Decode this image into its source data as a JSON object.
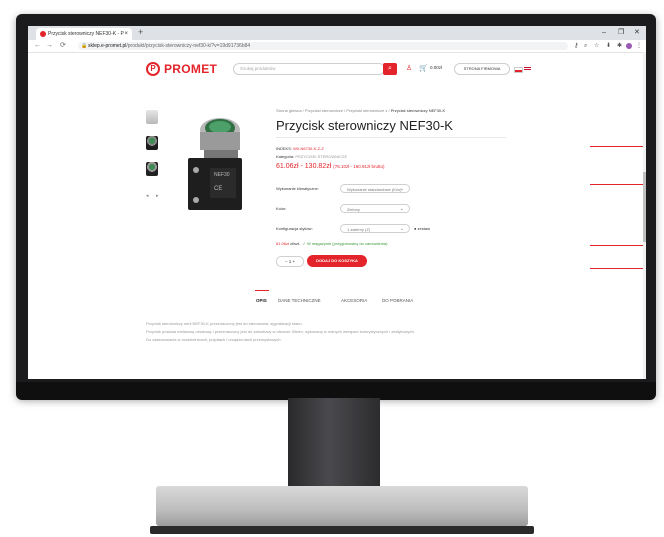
{
  "browser": {
    "tab_title": "Przycisk sterowniczy NEF30-K - P",
    "tab_close": "×",
    "new_tab": "+",
    "win_min": "–",
    "win_max": "❐",
    "win_close": "✕",
    "url_domain": "sklep.e-promet.pl",
    "url_path": "/produkt/przycisk-sterowniczy-nef30-k/?v=19d91736b84"
  },
  "header": {
    "logo_mark": "P",
    "logo_text": "PROMET",
    "search_placeholder": "Szukaj produktów",
    "cart_amount": "0.00zł",
    "main_page_button": "STRONA FIRMOWA"
  },
  "product": {
    "breadcrumb_path": "Strona główna / Przyciski sterownicze / Przyciski sterownicze z / ",
    "breadcrumb_current": "Przycisk sterowniczy NEF30-K",
    "title": "Przycisk sterowniczy NEF30-K",
    "index_label": "INDEKS:",
    "index_value": "W0-N6730-K-Z-Z",
    "category_label": "Kategoria:",
    "category_value": "PRZYCISKI STEROWNICZE",
    "price_net": "61.06zł - 130.82zł",
    "price_gross": "(75.10zł - 160.91zł brutto)",
    "options": [
      {
        "label": "Wykonanie klimatyczne:",
        "value": "Wykonanie standardowe (Ki/o)"
      },
      {
        "label": "Kolor:",
        "value": "Zielony"
      },
      {
        "label": "Konfiguracja styków:",
        "value": "1 zwierny (Z)"
      }
    ],
    "qty_side_label": "● zestaw",
    "stock_price": "61.06zł",
    "stock_unit": "zł/szt.",
    "stock_status": "✓ W magazynie (przygotowany do zamówienia)",
    "qty_minus": "−",
    "qty_value": "1",
    "qty_plus": "+",
    "add_to_cart": "DODAJ DO KOSZYKA"
  },
  "tabs": [
    "OPIS",
    "DANE TECHNICZNE",
    "AKCESORIA",
    "DO POBRANIA"
  ],
  "description": [
    "Przycisk sterowniczy serii NEF30-K przeznaczony jest do sterowania, sygnalizacji stanu.",
    "Przycisk posiada metalową obudowę i przeznaczony jest do zabudowy w otworze 30mm, wykonany w różnych wersjach kolorystycznych i zestykowych.",
    "Do zastosowania w rozdzielnicach, pulpitach i urządzeniach przemysłowych."
  ]
}
